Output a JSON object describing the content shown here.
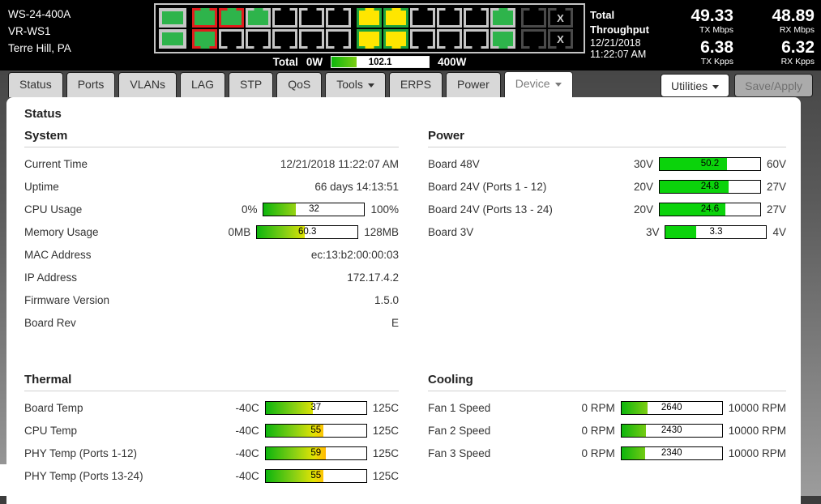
{
  "header": {
    "device": {
      "model": "WS-24-400A",
      "name": "VR-WS1",
      "location": "Terre Hill, PA"
    },
    "total_power": {
      "label": "Total",
      "min": "0W",
      "max": "400W",
      "value": "102.1",
      "pct": 25.5,
      "style": "gradient"
    },
    "throughput": {
      "title": "Total Throughput",
      "timestamp": "12/21/2018 11:22:07 AM",
      "stats": [
        {
          "value": "49.33",
          "label": "TX Mbps"
        },
        {
          "value": "48.89",
          "label": "RX Mbps"
        },
        {
          "value": "6.38",
          "label": "TX Kpps"
        },
        {
          "value": "6.32",
          "label": "RX Kpps"
        }
      ]
    },
    "ports": {
      "colors": {
        "green": "#2eb44b",
        "yellow": "#ffe600",
        "black": "#000000",
        "gray": "#c6c6c6",
        "red": "#e11d1d",
        "darkgreen": "#1fa33c",
        "dark": "#4a4a4a"
      },
      "groups": [
        {
          "name": "sfp",
          "type": "sfp",
          "cols": [
            {
              "top": {
                "frame": "gray",
                "fill": "green"
              },
              "bottom": {
                "frame": "gray",
                "fill": "green"
              }
            }
          ]
        },
        {
          "name": "ports-1-12",
          "type": "rj45",
          "cols": [
            {
              "top": {
                "frame": "red",
                "fill": "green"
              },
              "bottom": {
                "frame": "red",
                "fill": "green"
              }
            },
            {
              "top": {
                "frame": "red",
                "fill": "green"
              },
              "bottom": {
                "frame": "gray",
                "fill": "black"
              }
            },
            {
              "top": {
                "frame": "gray",
                "fill": "green"
              },
              "bottom": {
                "frame": "gray",
                "fill": "black"
              }
            },
            {
              "top": {
                "frame": "gray",
                "fill": "black"
              },
              "bottom": {
                "frame": "gray",
                "fill": "black"
              }
            },
            {
              "top": {
                "frame": "gray",
                "fill": "black"
              },
              "bottom": {
                "frame": "gray",
                "fill": "black"
              }
            },
            {
              "top": {
                "frame": "gray",
                "fill": "black"
              },
              "bottom": {
                "frame": "gray",
                "fill": "black"
              }
            }
          ]
        },
        {
          "name": "ports-13-24",
          "type": "rj45",
          "cols": [
            {
              "top": {
                "frame": "darkgreen",
                "fill": "yellow"
              },
              "bottom": {
                "frame": "darkgreen",
                "fill": "yellow"
              }
            },
            {
              "top": {
                "frame": "darkgreen",
                "fill": "yellow"
              },
              "bottom": {
                "frame": "darkgreen",
                "fill": "yellow"
              }
            },
            {
              "top": {
                "frame": "gray",
                "fill": "black"
              },
              "bottom": {
                "frame": "gray",
                "fill": "black"
              }
            },
            {
              "top": {
                "frame": "gray",
                "fill": "black"
              },
              "bottom": {
                "frame": "gray",
                "fill": "black"
              }
            },
            {
              "top": {
                "frame": "gray",
                "fill": "black"
              },
              "bottom": {
                "frame": "gray",
                "fill": "black"
              }
            },
            {
              "top": {
                "frame": "gray",
                "fill": "green"
              },
              "bottom": {
                "frame": "gray",
                "fill": "green"
              }
            }
          ]
        },
        {
          "name": "aux",
          "type": "rj45",
          "cols": [
            {
              "top": {
                "frame": "dark",
                "fill": "black"
              },
              "bottom": {
                "frame": "dark",
                "fill": "black"
              }
            },
            {
              "top": {
                "frame": "dark",
                "fill": "black",
                "label": "X"
              },
              "bottom": {
                "frame": "dark",
                "fill": "black",
                "label": "X"
              }
            }
          ]
        }
      ]
    }
  },
  "tabs": [
    {
      "label": "Status"
    },
    {
      "label": "Ports"
    },
    {
      "label": "VLANs"
    },
    {
      "label": "LAG"
    },
    {
      "label": "STP"
    },
    {
      "label": "QoS"
    },
    {
      "label": "Tools",
      "caret": true
    },
    {
      "label": "ERPS"
    },
    {
      "label": "Power"
    },
    {
      "label": "Device",
      "caret": true,
      "active": true
    }
  ],
  "actions": {
    "utilities": "Utilities",
    "save_apply": "Save/Apply"
  },
  "page": {
    "title": "Status"
  },
  "sections": [
    {
      "id": "system",
      "title": "System",
      "rows": [
        {
          "type": "text",
          "label": "Current Time",
          "value": "12/21/2018 11:22:07 AM"
        },
        {
          "type": "text",
          "label": "Uptime",
          "value": "66 days 14:13:51"
        },
        {
          "type": "bar",
          "label": "CPU Usage",
          "min": "0%",
          "max": "100%",
          "value": "32",
          "pct": 32,
          "style": "gradient"
        },
        {
          "type": "bar",
          "label": "Memory Usage",
          "min": "0MB",
          "max": "128MB",
          "value": "60.3",
          "pct": 47.1,
          "style": "gradient"
        },
        {
          "type": "text",
          "label": "MAC Address",
          "value": "ec:13:b2:00:00:03"
        },
        {
          "type": "text",
          "label": "IP Address",
          "value": "172.17.4.2"
        },
        {
          "type": "text",
          "label": "Firmware Version",
          "value": "1.5.0"
        },
        {
          "type": "text",
          "label": "Board Rev",
          "value": "E"
        }
      ]
    },
    {
      "id": "power",
      "title": "Power",
      "rows": [
        {
          "type": "bar",
          "label": "Board 48V",
          "min": "30V",
          "max": "60V",
          "value": "50.2",
          "pct": 67.3,
          "style": "solid"
        },
        {
          "type": "bar",
          "label": "Board 24V (Ports 1 - 12)",
          "min": "20V",
          "max": "27V",
          "value": "24.8",
          "pct": 68.6,
          "style": "solid"
        },
        {
          "type": "bar",
          "label": "Board 24V (Ports 13 - 24)",
          "min": "20V",
          "max": "27V",
          "value": "24.6",
          "pct": 65.7,
          "style": "solid"
        },
        {
          "type": "bar",
          "label": "Board 3V",
          "min": "3V",
          "max": "4V",
          "value": "3.3",
          "pct": 30,
          "style": "solid"
        }
      ]
    },
    {
      "id": "thermal",
      "title": "Thermal",
      "rows": [
        {
          "type": "bar",
          "label": "Board Temp",
          "min": "-40C",
          "max": "125C",
          "value": "37",
          "pct": 46.7,
          "style": "gradient"
        },
        {
          "type": "bar",
          "label": "CPU Temp",
          "min": "-40C",
          "max": "125C",
          "value": "55",
          "pct": 57.6,
          "style": "gradient"
        },
        {
          "type": "bar",
          "label": "PHY Temp (Ports 1-12)",
          "min": "-40C",
          "max": "125C",
          "value": "59",
          "pct": 60,
          "style": "gradient"
        },
        {
          "type": "bar",
          "label": "PHY Temp (Ports 13-24)",
          "min": "-40C",
          "max": "125C",
          "value": "55",
          "pct": 57.6,
          "style": "gradient"
        }
      ]
    },
    {
      "id": "cooling",
      "title": "Cooling",
      "rows": [
        {
          "type": "bar",
          "label": "Fan 1 Speed",
          "min": "0 RPM",
          "max": "10000 RPM",
          "value": "2640",
          "pct": 26.4,
          "style": "gradient"
        },
        {
          "type": "bar",
          "label": "Fan 2 Speed",
          "min": "0 RPM",
          "max": "10000 RPM",
          "value": "2430",
          "pct": 24.3,
          "style": "gradient"
        },
        {
          "type": "bar",
          "label": "Fan 3 Speed",
          "min": "0 RPM",
          "max": "10000 RPM",
          "value": "2340",
          "pct": 23.4,
          "style": "gradient"
        }
      ]
    }
  ]
}
